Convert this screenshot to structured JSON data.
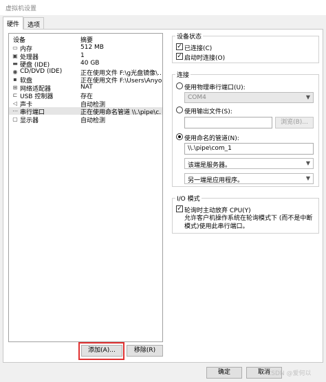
{
  "window": {
    "title": "虚拟机设置"
  },
  "tabs": [
    {
      "label": "硬件"
    },
    {
      "label": "选项"
    }
  ],
  "devices": {
    "header": {
      "device": "设备",
      "summary": "摘要"
    },
    "rows": [
      {
        "icon": "memory-icon",
        "glyph": "▭",
        "name": "内存",
        "summary": "512 MB"
      },
      {
        "icon": "cpu-icon",
        "glyph": "▣",
        "name": "处理器",
        "summary": "1"
      },
      {
        "icon": "harddisk-icon",
        "glyph": "▬",
        "name": "硬盘 (IDE)",
        "summary": "40 GB"
      },
      {
        "icon": "cdrom-icon",
        "glyph": "◉",
        "name": "CD/DVD (IDE)",
        "summary": "正在使用文件 F:\\g光盘镜像\\..."
      },
      {
        "icon": "floppy-icon",
        "glyph": "▪",
        "name": "软盘",
        "summary": "正在使用文件 F:\\Users\\Anyo..."
      },
      {
        "icon": "network-icon",
        "glyph": "⊞",
        "name": "网络适配器",
        "summary": "NAT"
      },
      {
        "icon": "usb-icon",
        "glyph": "⊏",
        "name": "USB 控制器",
        "summary": "存在"
      },
      {
        "icon": "sound-icon",
        "glyph": "◁",
        "name": "声卡",
        "summary": "自动检测"
      },
      {
        "icon": "serial-port-icon",
        "glyph": "⋯",
        "name": "串行端口",
        "summary": "正在使用命名管道 \\\\.\\pipe\\c..."
      },
      {
        "icon": "display-icon",
        "glyph": "▢",
        "name": "显示器",
        "summary": "自动检测"
      }
    ],
    "selected_index": 8
  },
  "buttons": {
    "add": "添加(A)...",
    "remove": "移除(R)",
    "ok": "确定",
    "cancel": "取消"
  },
  "device_status": {
    "title": "设备状态",
    "connected": {
      "label": "已连接(C)",
      "checked": true
    },
    "connect_at_power_on": {
      "label": "启动时连接(O)",
      "checked": true
    }
  },
  "connection": {
    "title": "连接",
    "physical": {
      "label": "使用物理串行端口(U):",
      "selected": false,
      "value": "COM4"
    },
    "output_file": {
      "label": "使用输出文件(S):",
      "selected": false,
      "value": "",
      "browse": "浏览(B)..."
    },
    "named_pipe": {
      "label": "使用命名的管道(N):",
      "selected": true,
      "value": "\\\\.\\pipe\\com_1",
      "end_option": "该端是服务器。",
      "other_end_option": "另一端是应用程序。"
    }
  },
  "io_mode": {
    "title": "I/O 模式",
    "yield_cpu": {
      "label": "轮询时主动放弃 CPU(Y)",
      "checked": true
    },
    "description": "允许客户机操作系统在轮询模式下 (而不是中断模式)使用此串行端口。"
  },
  "watermark": "CSDN @爱何以"
}
